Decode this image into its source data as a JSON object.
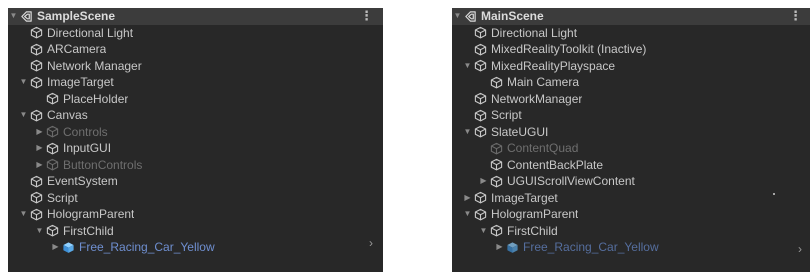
{
  "left_panel": {
    "scene": "SampleScene",
    "items": [
      {
        "label": "Directional Light",
        "depth": 1
      },
      {
        "label": "ARCamera",
        "depth": 1
      },
      {
        "label": "Network Manager",
        "depth": 1
      },
      {
        "label": "ImageTarget",
        "depth": 1,
        "expander": "expanded"
      },
      {
        "label": "PlaceHolder",
        "depth": 2
      },
      {
        "label": "Canvas",
        "depth": 1,
        "expander": "expanded"
      },
      {
        "label": "Controls",
        "depth": 2,
        "expander": "collapsed",
        "inactive": true
      },
      {
        "label": "InputGUI",
        "depth": 2,
        "expander": "collapsed"
      },
      {
        "label": "ButtonControls",
        "depth": 2,
        "expander": "collapsed",
        "inactive": true
      },
      {
        "label": "EventSystem",
        "depth": 1
      },
      {
        "label": "Script",
        "depth": 1
      },
      {
        "label": "HologramParent",
        "depth": 1,
        "expander": "expanded"
      },
      {
        "label": "FirstChild",
        "depth": 2,
        "expander": "expanded"
      },
      {
        "label": "Free_Racing_Car_Yellow",
        "depth": 3,
        "expander": "collapsed",
        "prefab": true
      }
    ]
  },
  "right_panel": {
    "scene": "MainScene",
    "items": [
      {
        "label": "Directional Light",
        "depth": 1
      },
      {
        "label": "MixedRealityToolkit (Inactive)",
        "depth": 1
      },
      {
        "label": "MixedRealityPlayspace",
        "depth": 1,
        "expander": "expanded"
      },
      {
        "label": "Main Camera",
        "depth": 2
      },
      {
        "label": "NetworkManager",
        "depth": 1
      },
      {
        "label": "Script",
        "depth": 1
      },
      {
        "label": "SlateUGUI",
        "depth": 1,
        "expander": "expanded"
      },
      {
        "label": "ContentQuad",
        "depth": 2,
        "inactive": true
      },
      {
        "label": "ContentBackPlate",
        "depth": 2
      },
      {
        "label": "UGUIScrollViewContent",
        "depth": 2,
        "expander": "collapsed"
      },
      {
        "label": "ImageTarget",
        "depth": 1,
        "expander": "collapsed"
      },
      {
        "label": "HologramParent",
        "depth": 1,
        "expander": "expanded"
      },
      {
        "label": "FirstChild",
        "depth": 2,
        "expander": "expanded"
      },
      {
        "label": "Free_Racing_Car_Yellow",
        "depth": 3,
        "expander": "collapsed",
        "prefab": true,
        "inactive": true
      }
    ]
  },
  "icons": {
    "scene": "unity-scene-icon",
    "gameobject": "cube-outline-icon",
    "prefab": "prefab-cube-icon",
    "menu": "kebab-menu-icon",
    "scroll_right": "chevron-right-icon"
  },
  "colors": {
    "panel_bg": "#282828",
    "header_bg": "#3c3c3c",
    "text": "#c8c8c8",
    "inactive_text": "#6f6f6f",
    "prefab_text": "#6f8fd0",
    "prefab_icon": "#5aa9e6"
  }
}
